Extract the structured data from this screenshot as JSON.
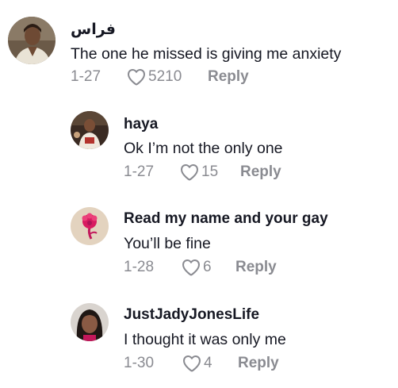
{
  "comments": [
    {
      "username": "فراس",
      "text": "The one he missed is giving me anxiety",
      "date": "1-27",
      "likes": "5210",
      "reply_label": "Reply"
    },
    {
      "username": "haya",
      "text": "Ok I’m not the only one",
      "date": "1-27",
      "likes": "15",
      "reply_label": "Reply"
    },
    {
      "username": "Read my name and your gay",
      "text": "You’ll be fine",
      "date": "1-28",
      "likes": "6",
      "reply_label": "Reply"
    },
    {
      "username": "JustJadyJonesLife",
      "text": "I thought it was only me",
      "date": "1-30",
      "likes": "4",
      "reply_label": "Reply"
    }
  ],
  "icons": {
    "like": "heart-outline-icon"
  },
  "colors": {
    "primary_text": "#161823",
    "secondary_text": "#8a8b91",
    "background": "#ffffff"
  }
}
